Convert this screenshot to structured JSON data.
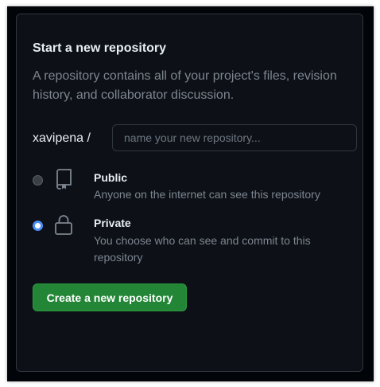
{
  "panel": {
    "title": "Start a new repository",
    "description": "A repository contains all of your project's files, revision history, and collaborator discussion."
  },
  "form": {
    "owner": "xavipena /",
    "repo_name_value": "",
    "repo_name_placeholder": "name your new repository..."
  },
  "visibility": {
    "selected": "private",
    "public": {
      "label": "Public",
      "description": "Anyone on the internet can see this repository",
      "icon": "repo-icon"
    },
    "private": {
      "label": "Private",
      "description": "You choose who can see and commit to this repository",
      "icon": "lock-icon"
    }
  },
  "actions": {
    "create_label": "Create a new repository"
  },
  "colors": {
    "background": "#0d1117",
    "border": "#30363d",
    "text_primary": "#e6edf3",
    "text_muted": "#7d8590",
    "button_green": "#238636",
    "radio_accent": "#4d8ef6"
  }
}
